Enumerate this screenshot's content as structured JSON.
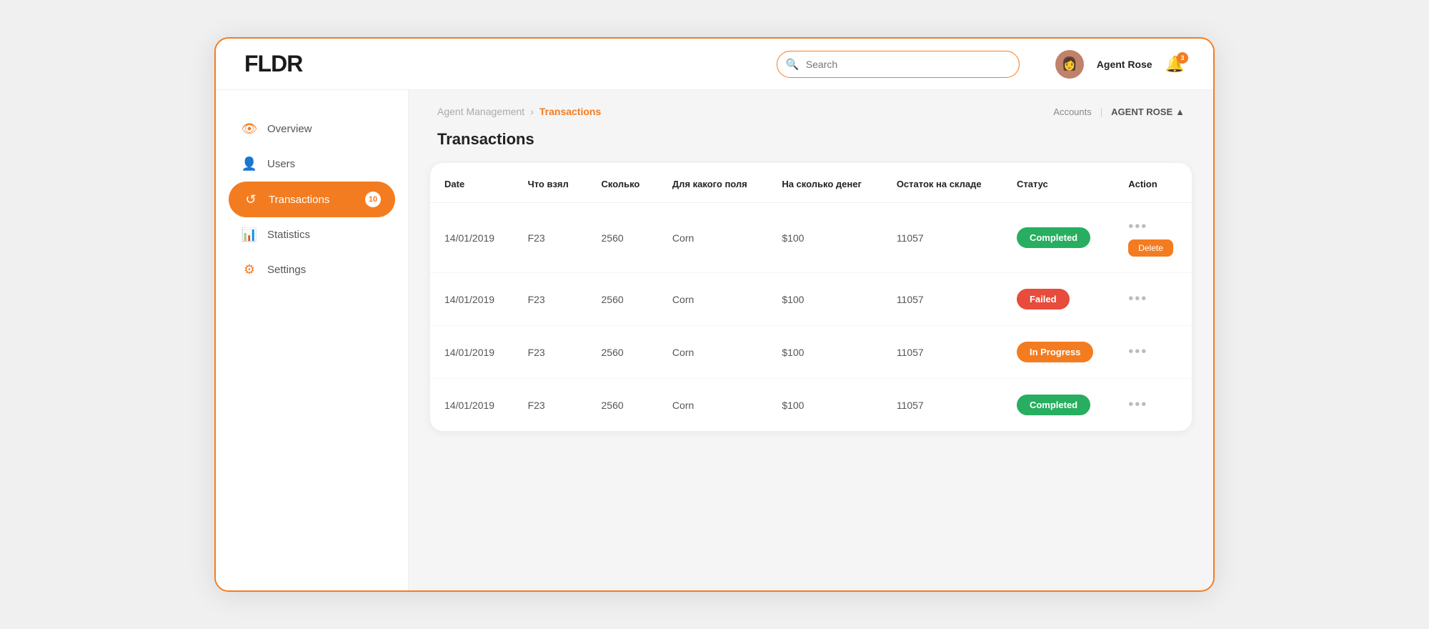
{
  "app": {
    "logo": "FLDR",
    "search_placeholder": "Search"
  },
  "header": {
    "agent_name": "Agent Rose",
    "bell_count": "3",
    "avatar_emoji": "👩"
  },
  "sidebar": {
    "items": [
      {
        "id": "overview",
        "label": "Overview",
        "icon": "👁",
        "active": false,
        "badge": null
      },
      {
        "id": "users",
        "label": "Users",
        "icon": "👤",
        "active": false,
        "badge": null
      },
      {
        "id": "transactions",
        "label": "Transactions",
        "icon": "↺",
        "active": true,
        "badge": "10"
      },
      {
        "id": "statistics",
        "label": "Statistics",
        "icon": "📊",
        "active": false,
        "badge": null
      },
      {
        "id": "settings",
        "label": "Settings",
        "icon": "⚙",
        "active": false,
        "badge": null
      }
    ]
  },
  "breadcrumb": {
    "parent": "Agent Management",
    "current": "Transactions"
  },
  "topbar_right": {
    "accounts_label": "Accounts",
    "user_label": "AGENT ROSE",
    "user_arrow": "▲"
  },
  "page_title": "Transactions",
  "table": {
    "columns": [
      "Date",
      "Что взял",
      "Сколько",
      "Для какого поля",
      "На сколько денег",
      "Остаток на складе",
      "Статус",
      "Action"
    ],
    "rows": [
      {
        "date": "14/01/2019",
        "what": "F23",
        "qty": "2560",
        "field": "Corn",
        "money": "$100",
        "stock": "11057",
        "status": "Completed",
        "status_key": "completed",
        "show_delete": true
      },
      {
        "date": "14/01/2019",
        "what": "F23",
        "qty": "2560",
        "field": "Corn",
        "money": "$100",
        "stock": "11057",
        "status": "Failed",
        "status_key": "failed",
        "show_delete": false
      },
      {
        "date": "14/01/2019",
        "what": "F23",
        "qty": "2560",
        "field": "Corn",
        "money": "$100",
        "stock": "11057",
        "status": "In Progress",
        "status_key": "inprogress",
        "show_delete": false
      },
      {
        "date": "14/01/2019",
        "what": "F23",
        "qty": "2560",
        "field": "Corn",
        "money": "$100",
        "stock": "11057",
        "status": "Completed",
        "status_key": "completed",
        "show_delete": false
      }
    ],
    "delete_label": "Delete"
  },
  "colors": {
    "accent": "#f47c20",
    "completed": "#27ae60",
    "failed": "#e74c3c",
    "inprogress": "#f47c20"
  }
}
